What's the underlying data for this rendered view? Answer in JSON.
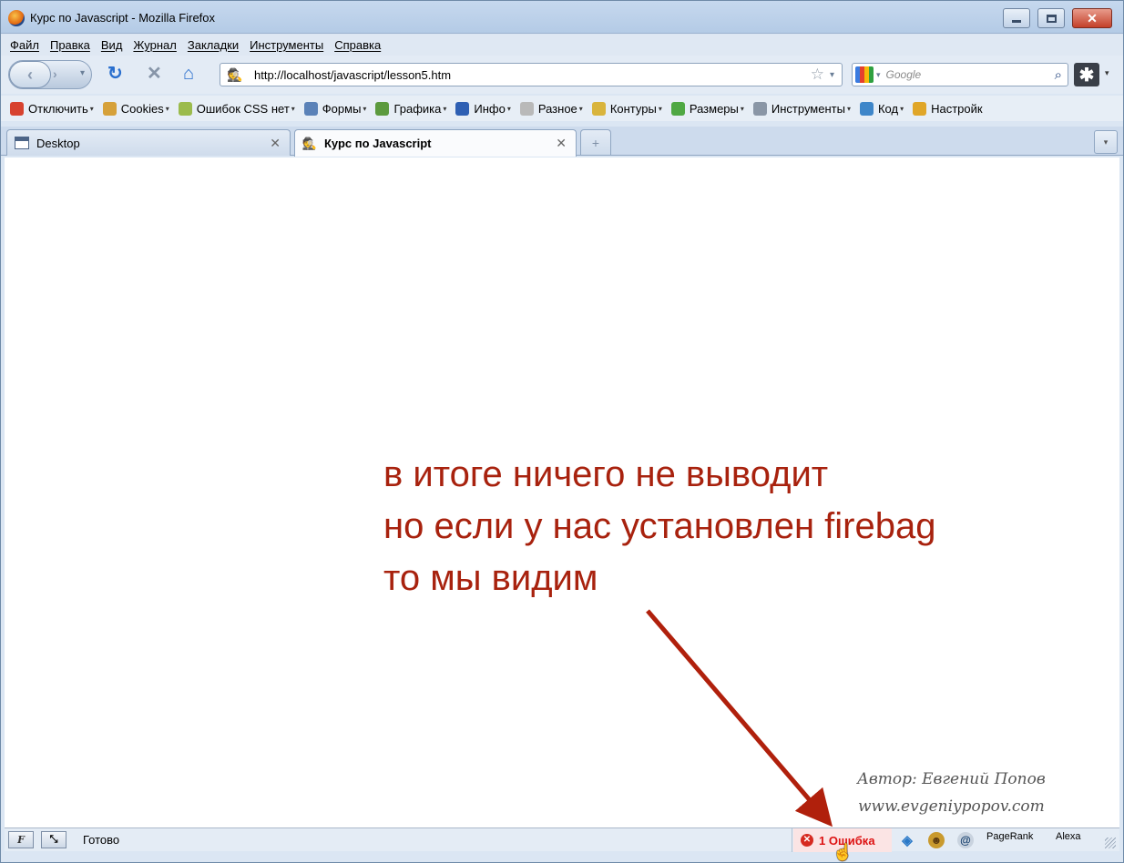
{
  "window": {
    "title": "Курс по Javascript - Mozilla Firefox"
  },
  "menu": [
    "Файл",
    "Правка",
    "Вид",
    "Журнал",
    "Закладки",
    "Инструменты",
    "Справка"
  ],
  "nav": {
    "url": "http://localhost/javascript/lesson5.htm",
    "search_placeholder": "Google"
  },
  "devbar": [
    {
      "label": "Отключить",
      "caret": true,
      "icon_color": "#d7422f"
    },
    {
      "label": "Cookies",
      "caret": true,
      "icon_color": "#d6a13a"
    },
    {
      "label": "Ошибок CSS нет",
      "caret": true,
      "icon_color": "#9bbb4c"
    },
    {
      "label": "Формы",
      "caret": true,
      "icon_color": "#5b82b8"
    },
    {
      "label": "Графика",
      "caret": true,
      "icon_color": "#5c9a3e"
    },
    {
      "label": "Инфо",
      "caret": true,
      "icon_color": "#2e5fb3"
    },
    {
      "label": "Разное",
      "caret": true,
      "icon_color": "#b9b9b9"
    },
    {
      "label": "Контуры",
      "caret": true,
      "icon_color": "#d9b43c"
    },
    {
      "label": "Размеры",
      "caret": true,
      "icon_color": "#4fa843"
    },
    {
      "label": "Инструменты",
      "caret": true,
      "icon_color": "#8a96a6"
    },
    {
      "label": "Код",
      "caret": true,
      "icon_color": "#3e86c9"
    },
    {
      "label": "Настройк",
      "caret": false,
      "icon_color": "#e0a628"
    }
  ],
  "tabs": [
    {
      "label": "Desktop"
    },
    {
      "label": "Курс по Javascript"
    }
  ],
  "content": {
    "note_lines": [
      "в итоге ничего не выводит",
      "но если у нас установлен firebag",
      "то мы видим"
    ],
    "author_line1": "Автор: Евгений Попов",
    "author_line2": "www.evgeniypopov.com"
  },
  "status": {
    "text": "Готово",
    "firebug_label": "F",
    "error_text": "1 Ошибка",
    "pagerank": "PageRank",
    "alexa": "Alexa"
  },
  "colors": {
    "note": "#a8220e",
    "error": "#d11111"
  }
}
